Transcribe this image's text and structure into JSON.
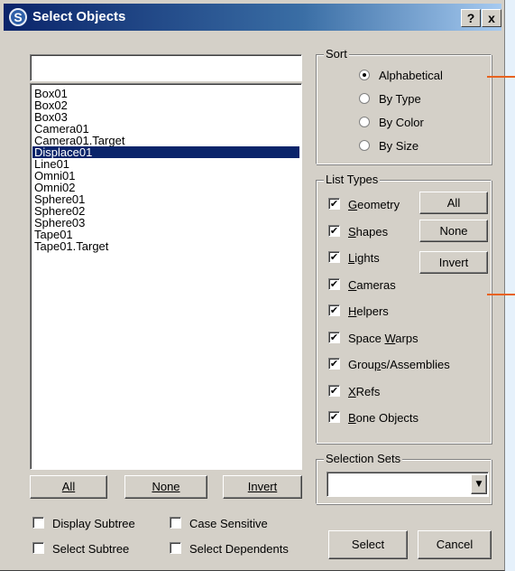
{
  "window": {
    "title": "Select Objects",
    "help_label": "?",
    "close_label": "x"
  },
  "filter": {
    "value": ""
  },
  "object_list": {
    "items": [
      "Box01",
      "Box02",
      "Box03",
      "Camera01",
      "Camera01.Target",
      "Displace01",
      "Line01",
      "Omni01",
      "Omni02",
      "Sphere01",
      "Sphere02",
      "Sphere03",
      "Tape01",
      "Tape01.Target"
    ],
    "selected": "Displace01"
  },
  "list_buttons": {
    "all": "All",
    "none": "None",
    "invert": "Invert"
  },
  "options": {
    "display_subtree": {
      "label": "Display Subtree",
      "checked": false
    },
    "case_sensitive": {
      "label": "Case Sensitive",
      "checked": false
    },
    "select_subtree": {
      "label": "Select Subtree",
      "checked": false
    },
    "select_dependents": {
      "label": "Select Dependents",
      "checked": false
    }
  },
  "sort": {
    "label": "Sort",
    "options": [
      "Alphabetical",
      "By Type",
      "By Color",
      "By Size"
    ],
    "selected": "Alphabetical"
  },
  "list_types": {
    "label": "List Types",
    "items": [
      {
        "label": "Geometry",
        "checked": true
      },
      {
        "label": "Shapes",
        "checked": true
      },
      {
        "label": "Lights",
        "checked": true
      },
      {
        "label": "Cameras",
        "checked": true
      },
      {
        "label": "Helpers",
        "checked": true
      },
      {
        "label": "Space Warps",
        "checked": true
      },
      {
        "label": "Groups/Assemblies",
        "checked": true
      },
      {
        "label": "XRefs",
        "checked": true
      },
      {
        "label": "Bone Objects",
        "checked": true
      }
    ],
    "all_label": "All",
    "none_label": "None",
    "invert_label": "Invert"
  },
  "selection_sets": {
    "label": "Selection Sets",
    "value": ""
  },
  "actions": {
    "select": "Select",
    "cancel": "Cancel"
  },
  "colors": {
    "selection": "#0a246a",
    "marker": "#e8621f",
    "face": "#d4d0c8"
  }
}
